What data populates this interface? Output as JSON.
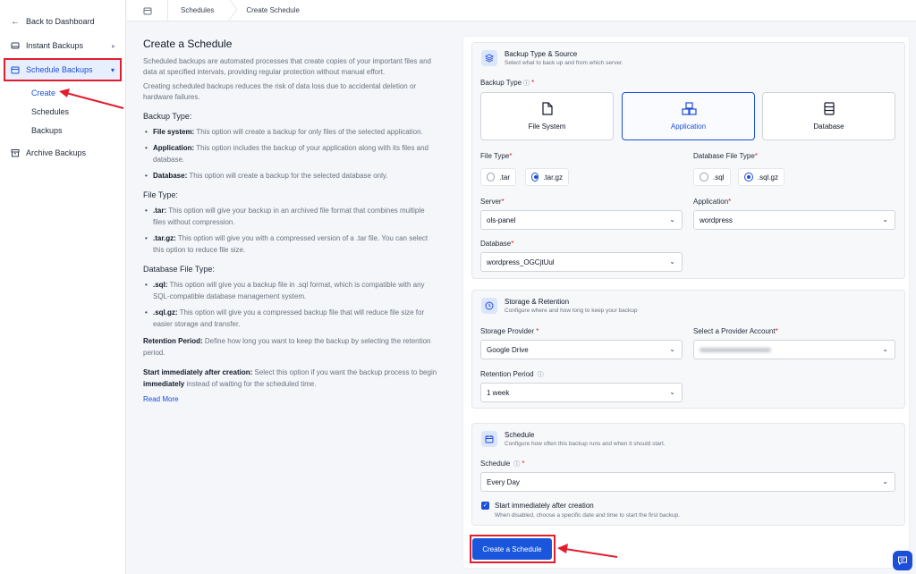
{
  "sidebar": {
    "back": "Back to Dashboard",
    "items": [
      {
        "label": "Instant Backups",
        "icon": "drive-icon"
      },
      {
        "label": "Schedule Backups",
        "icon": "calendar-icon"
      },
      {
        "label": "Archive Backups",
        "icon": "archive-icon"
      }
    ],
    "sub_items": [
      "Create",
      "Schedules",
      "Backups"
    ]
  },
  "breadcrumb": [
    "Schedules",
    "Create Schedule"
  ],
  "info": {
    "title": "Create a Schedule",
    "lead1": "Scheduled backups are automated processes that create copies of your important files and data at specified intervals, providing regular protection without manual effort.",
    "lead2": "Creating scheduled backups reduces the risk of data loss due to accidental deletion or hardware failures.",
    "backup_type_heading": "Backup Type:",
    "backup_type_items": [
      {
        "term": "File system:",
        "text": " This option will create a backup for only files of the selected application."
      },
      {
        "term": "Application:",
        "text": " This option includes the backup of your application along with its files and database."
      },
      {
        "term": "Database:",
        "text": " This option will create a backup for the selected database only."
      }
    ],
    "file_type_heading": "File Type:",
    "file_type_items": [
      {
        "term": ".tar:",
        "text": " This option will give your backup in an archived file format that combines multiple files without compression."
      },
      {
        "term": ".tar.gz:",
        "text": " This option will give you with a compressed version of a .tar file. You can select this option to reduce file size."
      }
    ],
    "db_file_type_heading": "Database File Type:",
    "db_file_type_items": [
      {
        "term": ".sql:",
        "text": " This option will give you a backup file in .sql format, which is compatible with any SQL-compatible database management system."
      },
      {
        "term": ".sql.gz:",
        "text": " This option will give you a compressed backup file that will reduce file size for easier storage and transfer."
      }
    ],
    "retention_term": "Retention Period:",
    "retention_text": " Define how long you want to keep the backup by selecting the retention period.",
    "start_term": "Start immediately after creation:",
    "start_text_a": " Select this option if you want the backup process to begin ",
    "start_text_b": "immediately",
    "start_text_c": " instead of waiting for the scheduled time.",
    "read_more": "Read More"
  },
  "source_card": {
    "title": "Backup Type & Source",
    "subtitle": "Select what to back up and from which server.",
    "backup_type_label": "Backup Type",
    "types": [
      {
        "label": "File System",
        "icon": "file-icon",
        "selected": false
      },
      {
        "label": "Application",
        "icon": "cubes-icon",
        "selected": true
      },
      {
        "label": "Database",
        "icon": "database-icon",
        "selected": false
      }
    ],
    "file_type_label": "File Type",
    "file_types": [
      {
        "label": ".tar",
        "checked": false
      },
      {
        "label": ".tar.gz",
        "checked": true
      }
    ],
    "db_file_type_label": "Database File Type",
    "db_file_types": [
      {
        "label": ".sql",
        "checked": false
      },
      {
        "label": ".sql.gz",
        "checked": true
      }
    ],
    "server_label": "Server",
    "server_value": "ols-panel",
    "application_label": "Application",
    "application_value": "wordpress",
    "database_label": "Database",
    "database_value": "wordpress_OGCjtUul"
  },
  "storage_card": {
    "title": "Storage & Retention",
    "subtitle": "Configure where and how long to keep your backup",
    "provider_label": "Storage Provider",
    "provider_value": "Google Drive",
    "account_label": "Select a Provider Account",
    "retention_label": "Retention Period",
    "retention_value": "1 week"
  },
  "schedule_card": {
    "title": "Schedule",
    "subtitle": "Configure how often this backup runs and when it should start.",
    "schedule_label": "Schedule",
    "schedule_value": "Every Day",
    "start_title": "Start immediately after creation",
    "start_sub": "When disabled, choose a specific date and time to start the first backup."
  },
  "submit_label": "Create a Schedule",
  "colors": {
    "accent": "#1d4ed8",
    "highlight": "#e11d2e"
  }
}
